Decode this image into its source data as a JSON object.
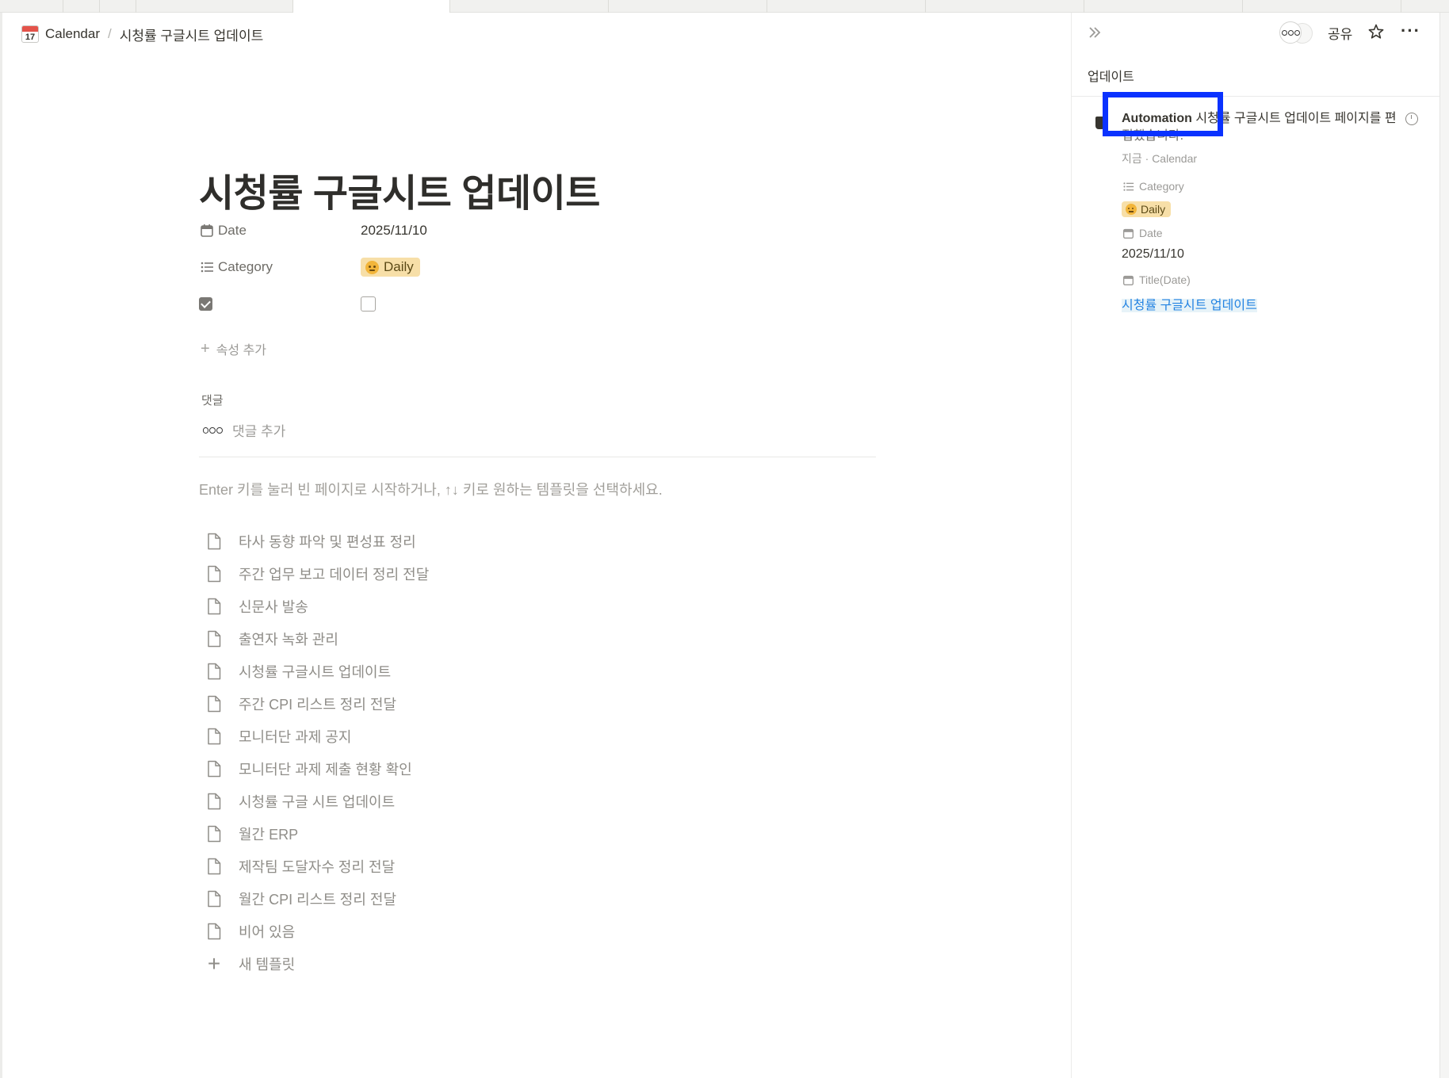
{
  "breadcrumb": {
    "calendar_day": "17",
    "root": "Calendar",
    "separator": "/",
    "current": "시청률 구글시트 업데이트"
  },
  "page": {
    "title": "시청률 구글시트 업데이트",
    "properties": {
      "date_label": "Date",
      "date_value": "2025/11/10",
      "category_label": "Category",
      "category_value": "Daily",
      "checkbox_checked": false
    },
    "add_property": "속성 추가",
    "comments_label": "댓글",
    "add_comment": "댓글 추가",
    "hint": "Enter 키를 눌러 빈 페이지로 시작하거나, ↑↓ 키로 원하는 템플릿을 선택하세요.",
    "templates": [
      "타사 동향 파악 및 편성표 정리",
      "주간 업무 보고 데이터 정리 전달",
      "신문사 발송",
      "출연자 녹화 관리",
      "시청률 구글시트 업데이트",
      "주간 CPI 리스트 정리 전달",
      "모니터단 과제 공지",
      "모니터단 과제 제출 현황 확인",
      "시청률 구글 시트 업데이트",
      "월간 ERP",
      "제작팀 도달자수 정리 전달",
      "월간 CPI 리스트 정리 전달",
      "비어 있음"
    ],
    "new_template": "새 템플릿"
  },
  "panel": {
    "share": "공유",
    "more": "···",
    "heading": "업데이트",
    "update": {
      "actor": "Automation",
      "text_line1": "시청률 구글시트 업데이트 페이지를 편",
      "text_line2": "집했습니다.",
      "meta": "지금 · Calendar"
    },
    "props": {
      "category_label": "Category",
      "category_value": "Daily",
      "date_label": "Date",
      "date_value": "2025/11/10",
      "title_label": "Title(Date)",
      "title_value": "시청률 구글시트 업데이트"
    }
  },
  "colors": {
    "highlight": "#0a32ff",
    "tag_bg": "#f7dfa8",
    "link": "#2383e2"
  }
}
